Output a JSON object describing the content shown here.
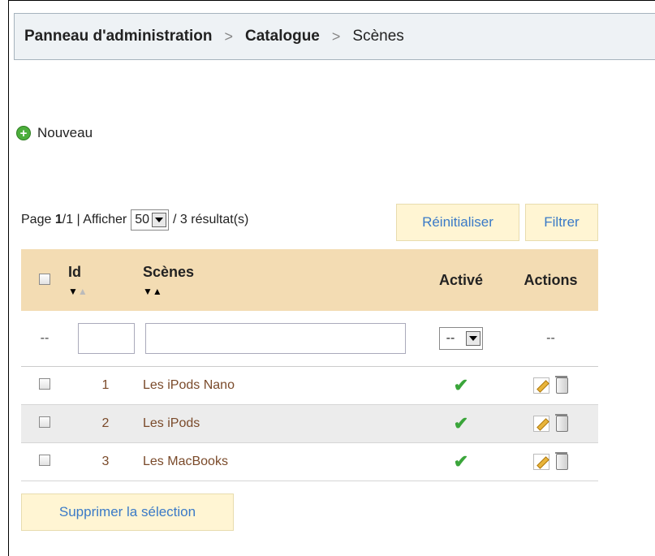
{
  "breadcrumb": {
    "items": [
      "Panneau d'administration",
      "Catalogue",
      "Scènes"
    ],
    "separator": ">"
  },
  "toolbar": {
    "new_label": "Nouveau"
  },
  "pagination": {
    "page_label": "Page",
    "current_page": "1",
    "page_sep": " / ",
    "total_pages": "1",
    "show_label": "| Afficher",
    "per_page": "50",
    "results_text": "/ 3 résultat(s)"
  },
  "buttons": {
    "reset": "Réinitialiser",
    "filter": "Filtrer",
    "delete_selection": "Supprimer la sélection"
  },
  "table": {
    "headers": {
      "id": "Id",
      "name": "Scènes",
      "active": "Activé",
      "actions": "Actions"
    },
    "filter_row": {
      "placeholder_dash": "--",
      "active_select": "--",
      "actions_dash": "--"
    },
    "rows": [
      {
        "id": "1",
        "name": "Les iPods Nano",
        "active": true
      },
      {
        "id": "2",
        "name": "Les iPods",
        "active": true
      },
      {
        "id": "3",
        "name": "Les MacBooks",
        "active": true
      }
    ]
  },
  "colors": {
    "header_bg": "#f3dcb3",
    "button_bg": "#fff5d3",
    "link": "#3a7ac7",
    "name_link": "#7a4a2a",
    "check": "#3aa53a"
  }
}
